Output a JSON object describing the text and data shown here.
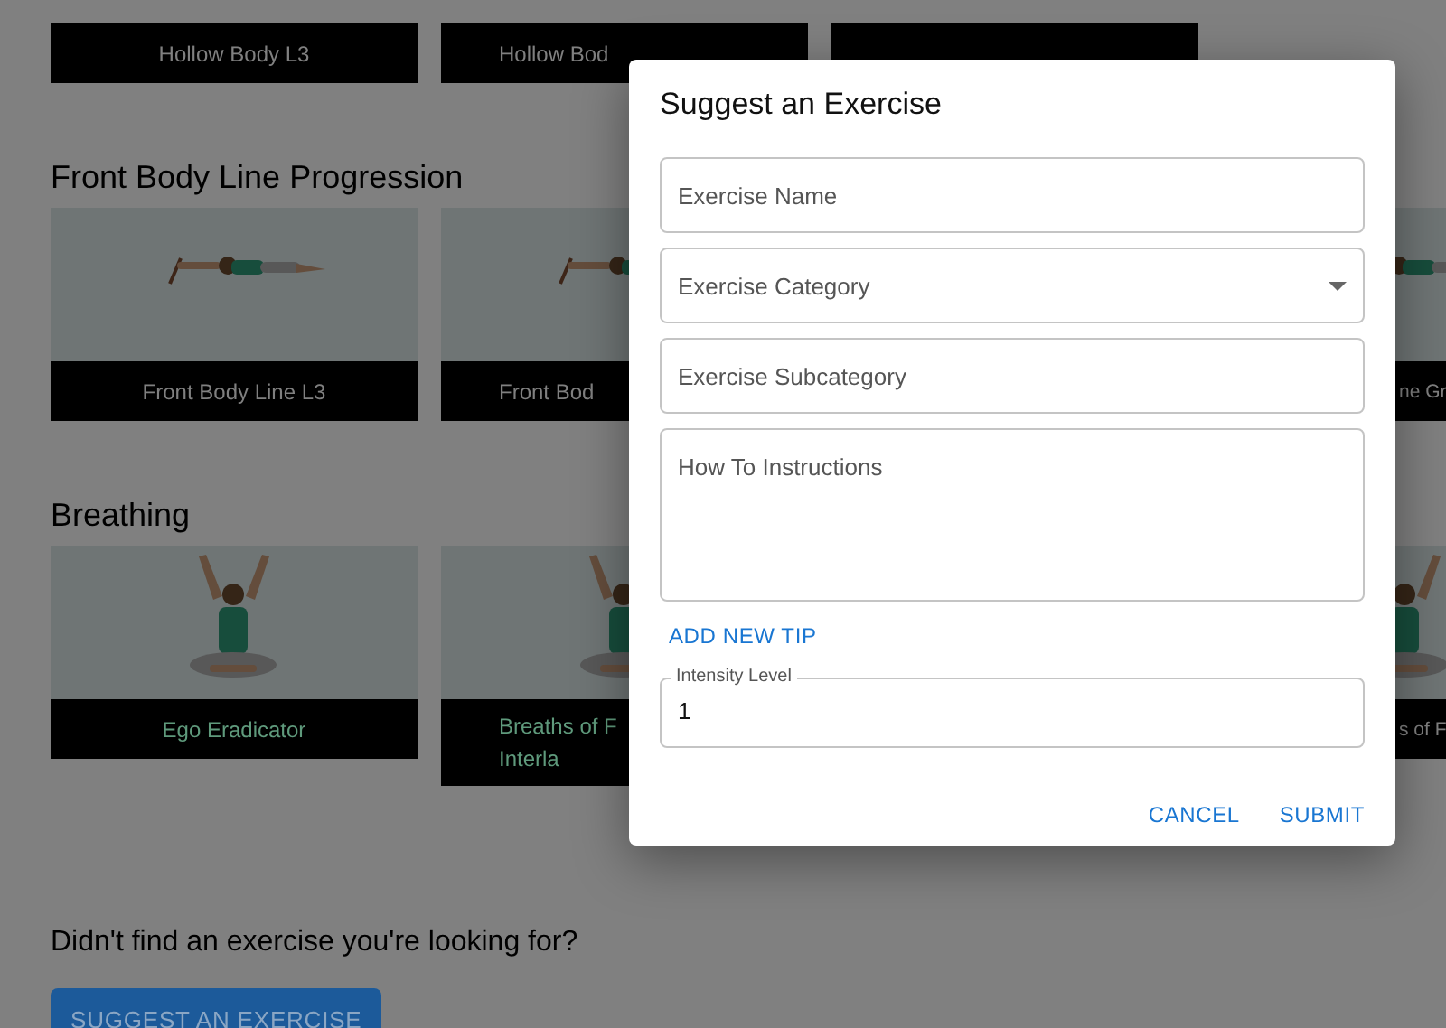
{
  "sections": [
    {
      "cards": [
        {
          "kind": "caption",
          "caption_lines": [
            "Hollow Body L3"
          ],
          "color": "#808080"
        },
        {
          "kind": "caption",
          "caption_lines": [
            "Hollow Bod"
          ],
          "color": "#808080"
        },
        {
          "kind": "caption"
        }
      ]
    },
    {
      "heading": "Front Body Line Progression",
      "cards": [
        {
          "kind": "picture",
          "caption_lines": [
            "Front Body Line L3"
          ],
          "color": "#808080"
        },
        {
          "kind": "picture",
          "caption_lines": [
            "Front Bod"
          ],
          "color": "#808080"
        },
        {
          "kind": "blank"
        },
        {
          "kind": "picture",
          "caption_lines": [
            "ne Gr"
          ],
          "color": "#808080"
        }
      ]
    },
    {
      "heading": "Breathing",
      "cards": [
        {
          "kind": "picture",
          "caption_lines": [
            "Ego Eradicator"
          ],
          "color": "#5f9a7c"
        },
        {
          "kind": "picture",
          "caption_lines": [
            "Breaths of F",
            "Interla"
          ],
          "color": "#5f9a7c"
        },
        {
          "kind": "blank"
        },
        {
          "kind": "picture",
          "caption_lines": [
            "s of F"
          ],
          "color": "#808080"
        }
      ]
    }
  ],
  "footer": {
    "prompt": "Didn't find an exercise you're looking for?",
    "button": "SUGGEST AN EXERCISE"
  },
  "dialog": {
    "title": "Suggest an Exercise",
    "fields": [
      {
        "kind": "text",
        "placeholder": "Exercise Name"
      },
      {
        "kind": "select",
        "placeholder": "Exercise Category"
      },
      {
        "kind": "text",
        "placeholder": "Exercise Subcategory"
      },
      {
        "kind": "textarea",
        "placeholder": "How To Instructions"
      }
    ],
    "add_tip": "ADD NEW TIP",
    "intensity": {
      "label": "Intensity Level",
      "value": "1"
    },
    "buttons": [
      "CANCEL",
      "SUBMIT"
    ]
  }
}
